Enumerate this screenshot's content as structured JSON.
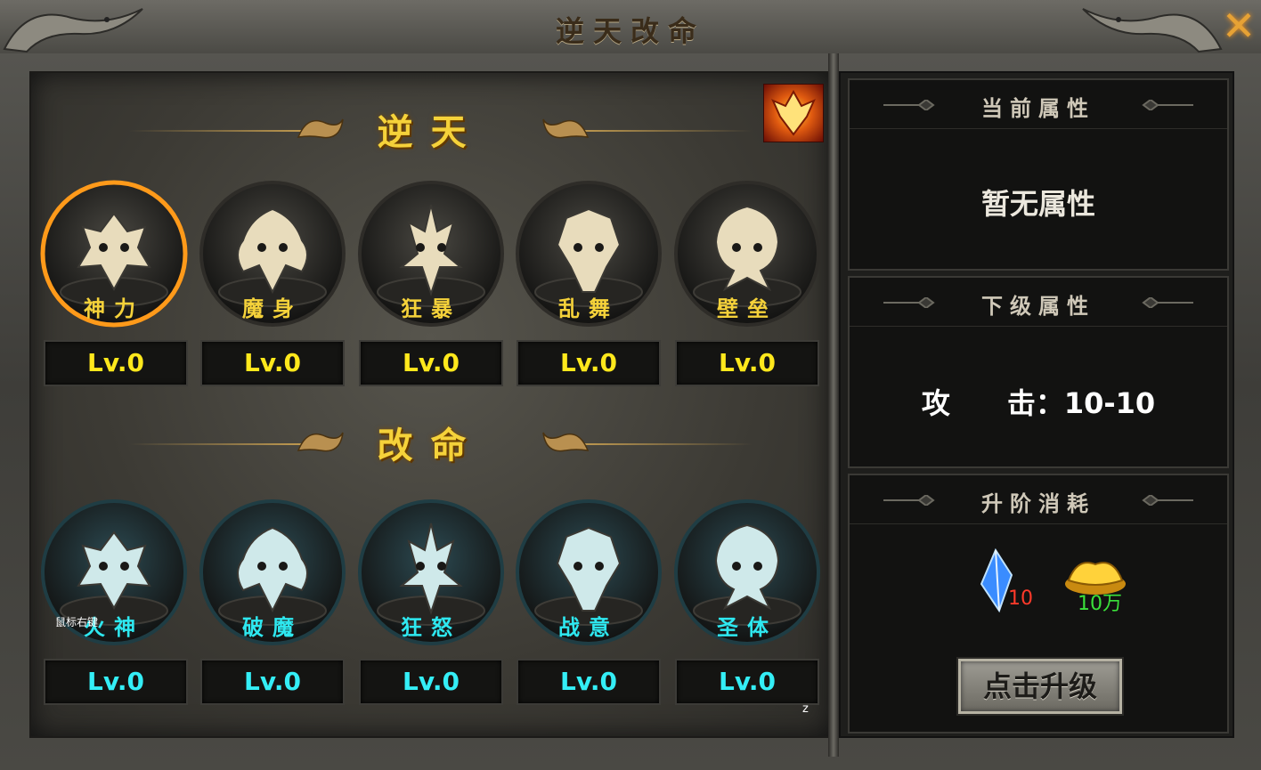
{
  "window": {
    "title": "逆天改命",
    "close_icon": "close-icon",
    "right_click_hint": "鼠标右键",
    "hotkey": "z"
  },
  "colors": {
    "gold": "#f5d23a",
    "cyan": "#2ee8f0",
    "lv_gold": "#ffe81c",
    "lv_cyan": "#34eef6",
    "cost_red": "#ff3a2a",
    "cost_green": "#3be23b"
  },
  "nitian": {
    "title": "逆天",
    "items": [
      {
        "name": "神力",
        "level": "Lv.0",
        "icon": "demon-skull-icon",
        "selected": true
      },
      {
        "name": "魔身",
        "level": "Lv.0",
        "icon": "horned-beast-icon",
        "selected": false
      },
      {
        "name": "狂暴",
        "level": "Lv.0",
        "icon": "sword-claw-icon",
        "selected": false
      },
      {
        "name": "乱舞",
        "level": "Lv.0",
        "icon": "trident-skull-icon",
        "selected": false
      },
      {
        "name": "壁垒",
        "level": "Lv.0",
        "icon": "tentacle-skull-icon",
        "selected": false
      }
    ]
  },
  "gaiming": {
    "title": "改命",
    "items": [
      {
        "name": "火神",
        "level": "Lv.0",
        "icon": "ram-skull-icon"
      },
      {
        "name": "破魔",
        "level": "Lv.0",
        "icon": "great-sword-icon"
      },
      {
        "name": "狂怒",
        "level": "Lv.0",
        "icon": "dragon-head-icon"
      },
      {
        "name": "战意",
        "level": "Lv.0",
        "icon": "gear-sword-icon"
      },
      {
        "name": "圣体",
        "level": "Lv.0",
        "icon": "heart-crest-icon"
      }
    ]
  },
  "badge_icon": "flame-crest-icon",
  "current_attr": {
    "title": "当前属性",
    "text": "暂无属性"
  },
  "next_attr": {
    "title": "下级属性",
    "label": "攻　　击：",
    "value": "10-10"
  },
  "cost": {
    "title": "升阶消耗",
    "items": [
      {
        "icon": "blue-crystal-icon",
        "amount": "10",
        "color": "red"
      },
      {
        "icon": "gold-ingot-icon",
        "amount": "10万",
        "color": "green"
      }
    ],
    "button": "点击升级"
  }
}
